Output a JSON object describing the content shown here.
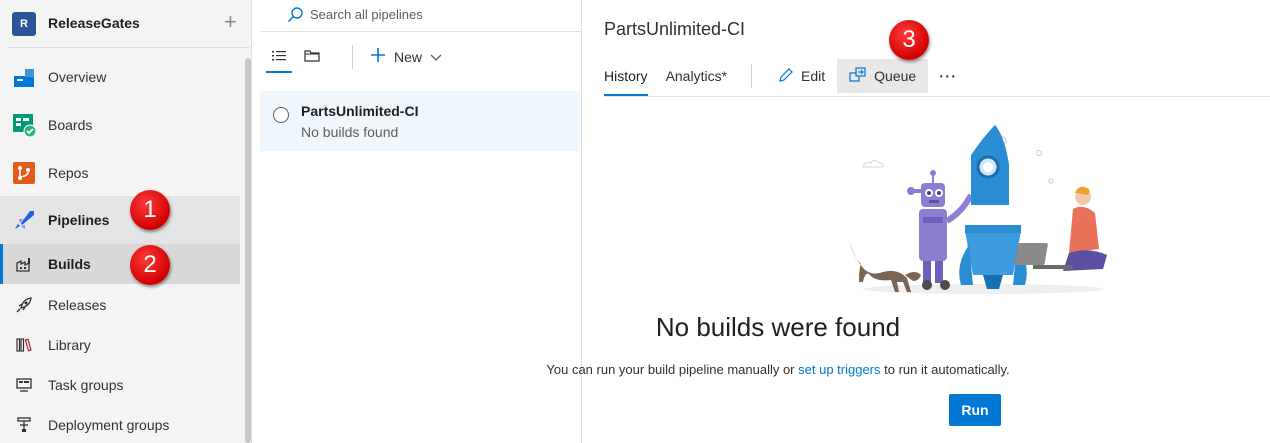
{
  "org": {
    "initial": "R",
    "name": "ReleaseGates"
  },
  "nav": {
    "items": [
      {
        "label": "Overview",
        "icon": "overview-icon"
      },
      {
        "label": "Boards",
        "icon": "boards-icon"
      },
      {
        "label": "Repos",
        "icon": "repos-icon"
      },
      {
        "label": "Pipelines",
        "icon": "pipelines-icon"
      },
      {
        "label": "Builds",
        "icon": "builds-icon"
      },
      {
        "label": "Releases",
        "icon": "releases-icon"
      },
      {
        "label": "Library",
        "icon": "library-icon"
      },
      {
        "label": "Task groups",
        "icon": "task-groups-icon"
      },
      {
        "label": "Deployment groups",
        "icon": "deployment-groups-icon"
      }
    ]
  },
  "callouts": [
    "1",
    "2",
    "3"
  ],
  "pipelines_list": {
    "search_placeholder": "Search all pipelines",
    "new_label": "New",
    "rows": [
      {
        "name": "PartsUnlimited-CI",
        "status": "No builds found"
      }
    ]
  },
  "detail": {
    "title": "PartsUnlimited-CI",
    "tabs": [
      "History",
      "Analytics*"
    ],
    "actions": {
      "edit": "Edit",
      "queue": "Queue",
      "more": "⋯"
    },
    "empty": {
      "heading": "No builds were found",
      "message_pre": "You can run your build pipeline manually or ",
      "message_link": "set up triggers",
      "message_post": " to run it automatically.",
      "run_label": "Run"
    }
  },
  "colors": {
    "accent": "#0078d4",
    "badge": "#e00000",
    "selected_bg": "#d8d8d8"
  }
}
